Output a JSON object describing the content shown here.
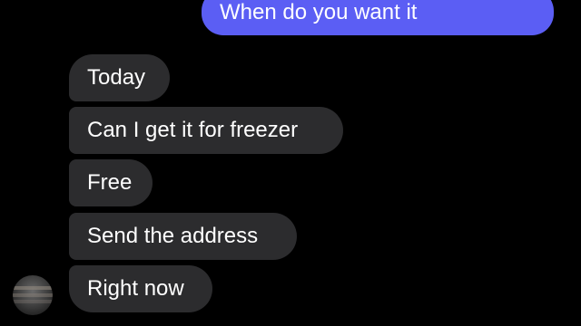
{
  "colors": {
    "background": "#000000",
    "outgoing_bubble": "#5b5ef4",
    "incoming_bubble": "#2c2c2e",
    "text": "#ffffff"
  },
  "outgoing": [
    {
      "text": "When do you want it"
    }
  ],
  "incoming": [
    {
      "text": "Today"
    },
    {
      "text": "Can I get it for freezer"
    },
    {
      "text": "Free"
    },
    {
      "text": "Send the address"
    },
    {
      "text": "Right now"
    }
  ],
  "avatar": {
    "icon": "contact-avatar-photo"
  }
}
